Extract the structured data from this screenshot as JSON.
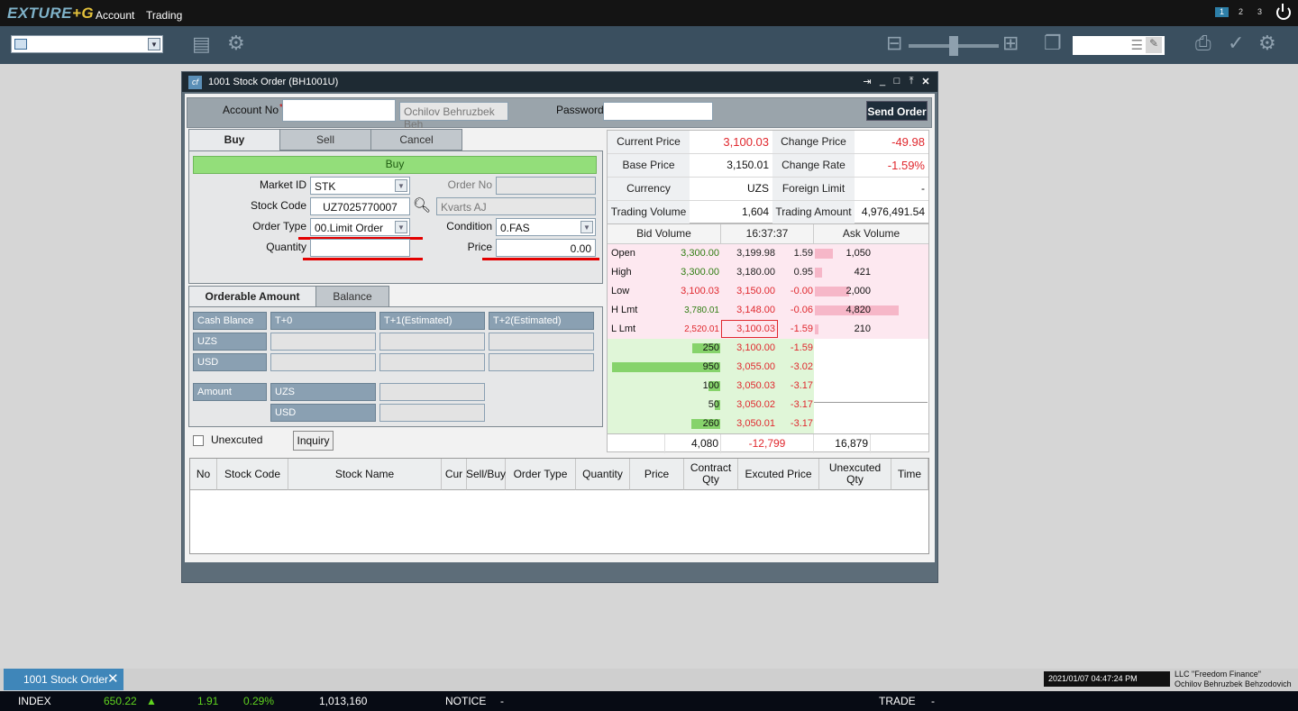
{
  "app": {
    "logo_main": "EXTURE",
    "logo_accent": "+G",
    "menu": [
      "Account",
      "Trading"
    ],
    "workspaces": [
      "1",
      "2",
      "3"
    ]
  },
  "window": {
    "title": "1001 Stock Order (BH1001U)"
  },
  "account": {
    "account_no_label": "Account No",
    "required_mark": "*",
    "account_no_value": "",
    "account_name": "Ochilov Behruzbek Beh",
    "password_label": "Password",
    "password_value": "",
    "send_order_label": "Send Order"
  },
  "order_tabs": [
    "Buy",
    "Sell",
    "Cancel"
  ],
  "order_form": {
    "mode_banner": "Buy",
    "market_id_label": "Market ID",
    "market_id_value": "STK",
    "order_no_label": "Order No",
    "order_no_value": "",
    "stock_code_label": "Stock Code",
    "stock_code_value": "UZ7025770007",
    "stock_name": "Kvarts AJ",
    "order_type_label": "Order Type",
    "order_type_value": "00.Limit Order",
    "condition_label": "Condition",
    "condition_value": "0.FAS",
    "quantity_label": "Quantity",
    "quantity_value": "",
    "price_label": "Price",
    "price_value": "0.00"
  },
  "amount_tabs": [
    "Orderable Amount",
    "Balance"
  ],
  "amount_grid": {
    "headers": [
      "Cash Blance",
      "T+0",
      "T+1(Estimated)",
      "T+2(Estimated)"
    ],
    "rows": [
      "UZS",
      "USD"
    ],
    "amount_label": "Amount",
    "amount_rows": [
      "UZS",
      "USD"
    ]
  },
  "unexecuted_label": "Unexcuted",
  "inquiry_label": "Inquiry",
  "price_info": [
    {
      "label": "Current Price",
      "value": "3,100.03",
      "label2": "Change Price",
      "value2": "-49.98"
    },
    {
      "label": "Base Price",
      "value": "3,150.01",
      "label2": "Change Rate",
      "value2": "-1.59%"
    },
    {
      "label": "Currency",
      "value": "UZS",
      "label2": "Foreign Limit",
      "value2": "-"
    },
    {
      "label": "Trading Volume",
      "value": "1,604",
      "label2": "Trading Amount",
      "value2": "4,976,491.54"
    }
  ],
  "order_book": {
    "headers": [
      "Bid Volume",
      "16:37:37",
      "Ask Volume"
    ],
    "ask_rows": [
      {
        "label": "Open",
        "left": "3,300.00",
        "price": "3,199.98",
        "chg": "1.59",
        "vol": "1,050",
        "fill": 0.22
      },
      {
        "label": "High",
        "left": "3,300.00",
        "price": "3,180.00",
        "chg": "0.95",
        "vol": "421",
        "fill": 0.09
      },
      {
        "label": "Low",
        "left": "3,100.03",
        "price": "3,150.00",
        "chg": "-0.00",
        "vol": "2,000",
        "fill": 0.41
      },
      {
        "label": "H Lmt",
        "left": "3,780.01",
        "price": "3,148.00",
        "chg": "-0.06",
        "vol": "4,820",
        "fill": 1.0
      },
      {
        "label": "L Lmt",
        "left": "2,520.01",
        "price": "3,100.03",
        "chg": "-1.59",
        "vol": "210",
        "fill": 0.04
      }
    ],
    "bid_rows": [
      {
        "vol": "250",
        "price": "3,100.00",
        "chg": "-1.59",
        "fill": 0.26
      },
      {
        "vol": "950",
        "price": "3,055.00",
        "chg": "-3.02",
        "fill": 1.0
      },
      {
        "vol": "100",
        "price": "3,050.03",
        "chg": "-3.17",
        "fill": 0.11
      },
      {
        "vol": "50",
        "price": "3,050.02",
        "chg": "-3.17",
        "fill": 0.05
      },
      {
        "vol": "260",
        "price": "3,050.01",
        "chg": "-3.17",
        "fill": 0.27
      }
    ],
    "totals": {
      "bid": "4,080",
      "diff": "-12,799",
      "ask": "16,879"
    }
  },
  "orders_table": {
    "columns": [
      "No",
      "Stock Code",
      "Stock Name",
      "Cur",
      "Sell/Buy",
      "Order Type",
      "Quantity",
      "Price",
      "Contract Qty",
      "Excuted Price",
      "Unexcuted Qty",
      "Time"
    ]
  },
  "taskbar": {
    "tab_label": "1001 Stock Order",
    "datetime": "2021/01/07 04:47:24 PM",
    "company": "LLC \"Freedom Finance\"",
    "user": "Ochilov Behruzbek Behzodovich"
  },
  "ticker": {
    "index_label": "INDEX",
    "index_value": "650.22",
    "change": "1.91",
    "change_pct": "0.29%",
    "volume": "1,013,160",
    "notice_label": "NOTICE",
    "notice_value": "-",
    "trade_label": "TRADE",
    "trade_value": "-"
  },
  "colors": {
    "accent": "#3f86b9",
    "buy_green": "#93de7a",
    "down_red": "#e0282e",
    "up_green": "#2f7d12"
  }
}
